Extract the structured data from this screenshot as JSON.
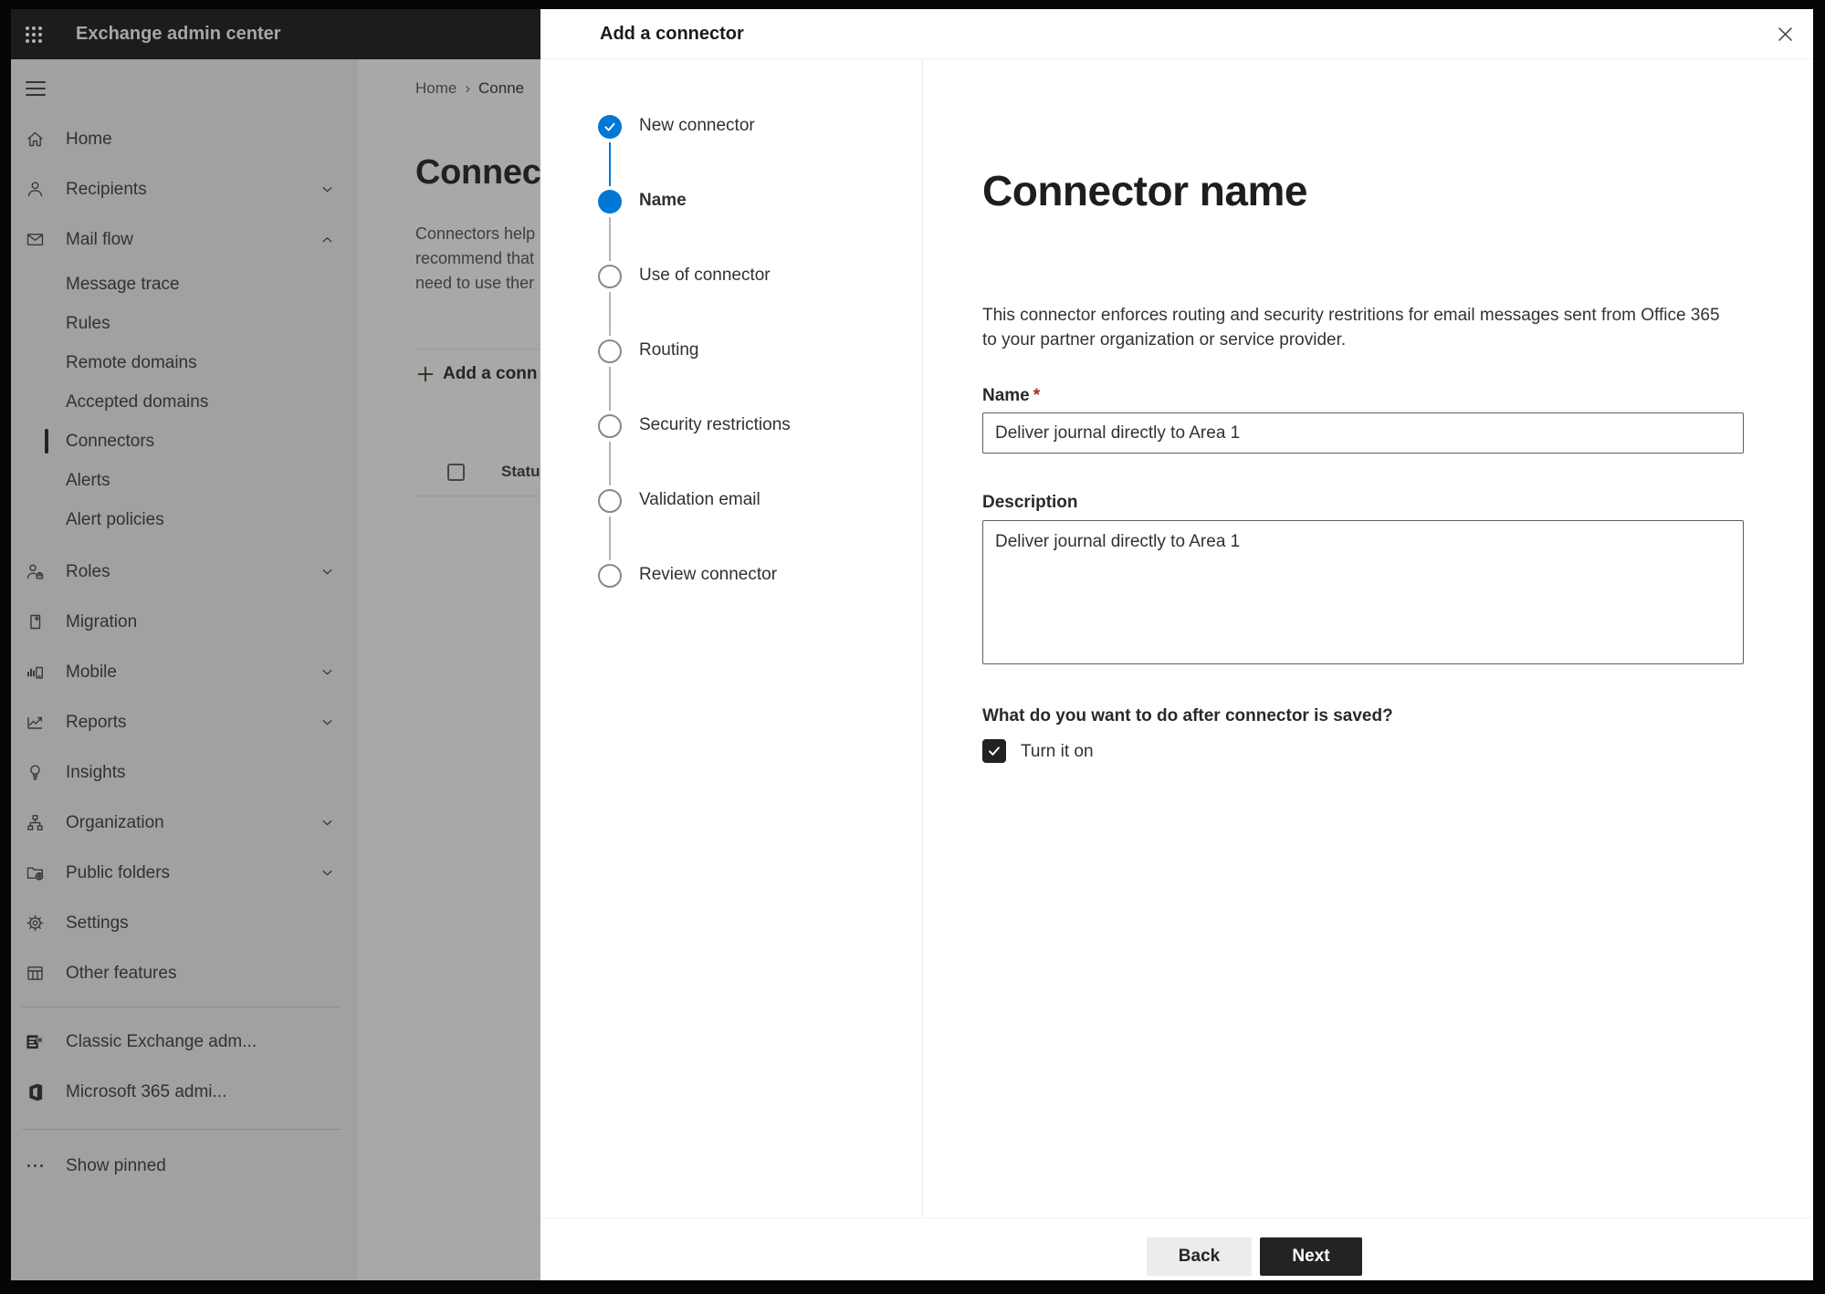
{
  "app": {
    "header": {
      "title": "Exchange admin center"
    }
  },
  "colors": {
    "accent_blue": "#0078d4",
    "next_button_bg": "#242322",
    "required_red": "#a4262c",
    "header_bg": "#1d1c1b"
  },
  "icons": {
    "checkmark": "✓",
    "close": "✕",
    "chevron_right": "›",
    "plus": "+",
    "ellipsis": "···"
  },
  "sidebar": {
    "items": [
      {
        "label": "Home"
      },
      {
        "label": "Recipients"
      },
      {
        "label": "Mail flow"
      },
      {
        "label": "Message trace"
      },
      {
        "label": "Rules"
      },
      {
        "label": "Remote domains"
      },
      {
        "label": "Accepted domains"
      },
      {
        "label": "Connectors",
        "selected": true
      },
      {
        "label": "Alerts"
      },
      {
        "label": "Alert policies"
      },
      {
        "label": "Roles"
      },
      {
        "label": "Migration"
      },
      {
        "label": "Mobile"
      },
      {
        "label": "Reports"
      },
      {
        "label": "Insights"
      },
      {
        "label": "Organization"
      },
      {
        "label": "Public folders"
      },
      {
        "label": "Settings"
      },
      {
        "label": "Other features"
      },
      {
        "label": "Classic Exchange adm..."
      },
      {
        "label": "Microsoft 365 admi..."
      },
      {
        "label": "Show pinned"
      }
    ]
  },
  "page": {
    "breadcrumb": {
      "home": "Home",
      "separator": "›",
      "current": "Conne"
    },
    "title_fragment": "Connec",
    "description_lines": [
      "Connectors help",
      "recommend that",
      "need to use ther"
    ],
    "add_button_label": "Add a conn",
    "table": {
      "status_header": "Status",
      "select_all_checked": false
    }
  },
  "modal": {
    "title": "Add a connector",
    "steps": [
      {
        "label": "New connector",
        "state": "done"
      },
      {
        "label": "Name",
        "state": "current"
      },
      {
        "label": "Use of connector",
        "state": "upcoming"
      },
      {
        "label": "Routing",
        "state": "upcoming"
      },
      {
        "label": "Security restrictions",
        "state": "upcoming"
      },
      {
        "label": "Validation email",
        "state": "upcoming"
      },
      {
        "label": "Review connector",
        "state": "upcoming"
      }
    ],
    "content": {
      "heading": "Connector name",
      "description_lines": [
        "This connector enforces routing and security restritions for email messages sent from Office 365",
        "to your partner organization or service provider."
      ],
      "name_label": "Name",
      "required_marker": "*",
      "name_value": "Deliver journal directly to Area 1",
      "description_label": "Description",
      "description_value": "Deliver journal directly to Area 1",
      "after_save_question": "What do you want to do after connector is saved?",
      "turn_on_label": "Turn it on",
      "turn_on_checked": true
    },
    "footer": {
      "back_label": "Back",
      "next_label": "Next"
    }
  }
}
